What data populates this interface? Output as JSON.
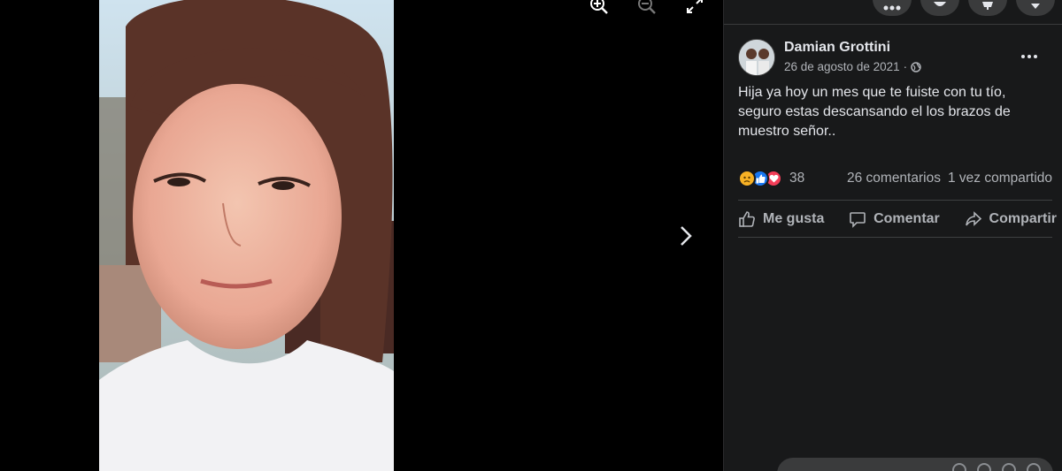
{
  "post": {
    "author": "Damian Grottini",
    "date": "26 de agosto de 2021",
    "separator": "·",
    "text": "Hija ya hoy un mes que te fuiste con tu tío, seguro estas descansando el los brazos de muestro señor..",
    "reactions_count": "38",
    "comments": "26 comentarios",
    "shares": "1 vez compartido"
  },
  "actions": {
    "like": "Me gusta",
    "comment": "Comentar",
    "share": "Compartir"
  },
  "icons": {
    "audience": "globe-icon",
    "reactions": [
      "sad-reaction-icon",
      "like-reaction-icon",
      "love-reaction-icon"
    ]
  },
  "colors": {
    "panel_bg": "#18191a",
    "text_primary": "#e4e6eb",
    "text_secondary": "#b0b3b8",
    "like_blue": "#1877f2",
    "love_red": "#f33e58",
    "sad_yellow": "#f7b125"
  }
}
